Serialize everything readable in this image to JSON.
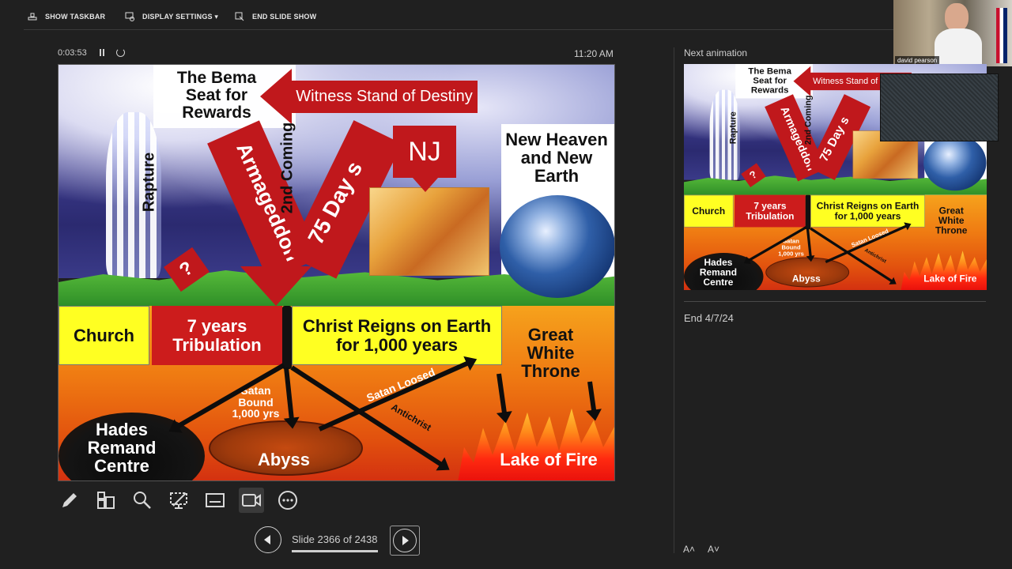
{
  "toolbar": {
    "show_taskbar": "SHOW TASKBAR",
    "display_settings": "DISPLAY SETTINGS ▾",
    "end_slide_show": "END SLIDE SHOW"
  },
  "presenter": {
    "elapsed": "0:03:53",
    "clock": "11:20 AM",
    "next_label": "Next animation",
    "notes": "End 4/7/24",
    "slide_counter": "Slide 2366 of 2438",
    "current_slide": 2366,
    "total_slides": 2438,
    "increase_font": "A˄",
    "decrease_font": "A˅"
  },
  "webcam": {
    "name": "david pearson"
  },
  "slide": {
    "bema": "The Bema Seat for Rewards",
    "witness": "Witness Stand of Destiny",
    "rapture": "Rapture",
    "armageddon": "Armageddon",
    "second_coming": "2nd Coming",
    "days75": "75 Day s",
    "nj": "NJ",
    "new_heaven": "New Heaven and New Earth",
    "question": "?",
    "church": "Church",
    "tribulation": "7 years Tribulation",
    "reign": "Christ Reigns on Earth for 1,000 years",
    "great_white_throne": "Great White Throne",
    "satan_bound": "Satan Bound 1,000 yrs",
    "satan_loosed": "Satan Loosed",
    "antichrist": "Antichrist",
    "hades": "Hades Remand Centre",
    "abyss": "Abyss",
    "lake_of_fire": "Lake of Fire"
  },
  "colors": {
    "accent_red": "#c0181c",
    "yellow": "#ffff22",
    "background": "#202020"
  }
}
